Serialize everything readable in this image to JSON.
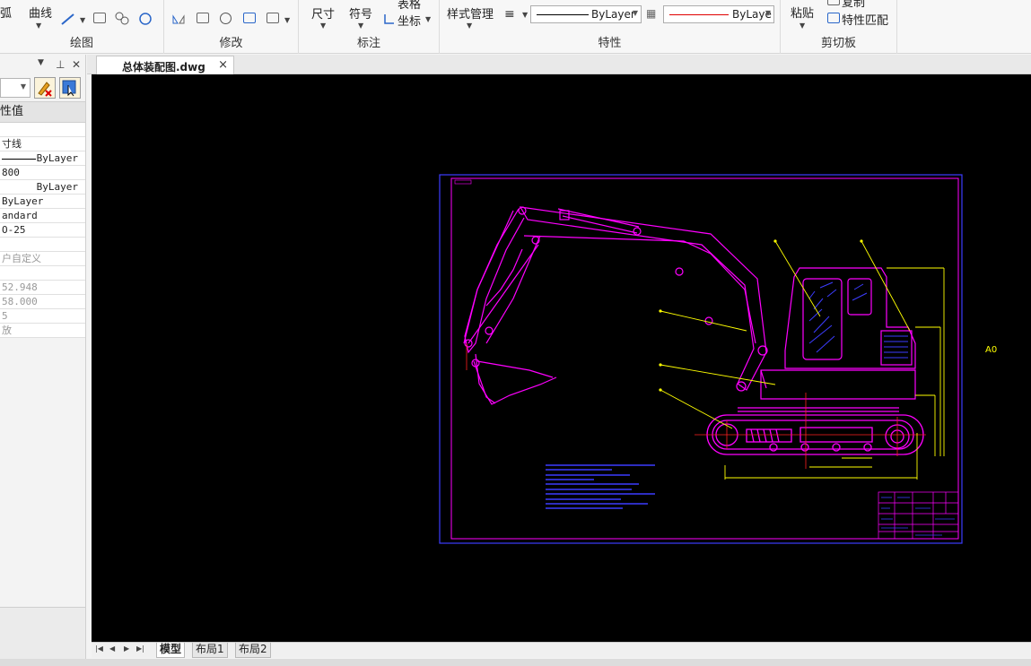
{
  "ribbon": {
    "draw_group": {
      "title": "绘图",
      "arc_label": "弧",
      "curve_label": "曲线"
    },
    "modify_group": {
      "title": "修改"
    },
    "annotate_group": {
      "title": "标注",
      "dimension_label": "尺寸",
      "symbol_label": "符号",
      "table_label": "表格",
      "coord_label": "坐标"
    },
    "props_group": {
      "title": "特性",
      "style_manager_label": "样式管理",
      "linetype_value": "ByLayer",
      "color_value": "ByLaye"
    },
    "clipboard_group": {
      "title": "剪切板",
      "paste_label": "粘贴",
      "copy_label": "复制",
      "match_props_label": "特性匹配"
    }
  },
  "panel": {
    "header_label": "性值",
    "rows": [
      {
        "text": "",
        "gray": false
      },
      {
        "text": "寸线",
        "gray": false
      },
      {
        "text": "ByLayer",
        "gray": false,
        "line": true
      },
      {
        "text": "800",
        "gray": false
      },
      {
        "text": "ByLayer",
        "gray": false,
        "right": true
      },
      {
        "text": "ByLayer",
        "gray": false
      },
      {
        "text": "andard",
        "gray": false
      },
      {
        "text": "O-25",
        "gray": false
      },
      {
        "text": "",
        "gray": false
      },
      {
        "text": "户自定义",
        "gray": true
      },
      {
        "text": "",
        "gray": true
      },
      {
        "text": "52.948",
        "gray": true
      },
      {
        "text": "58.000",
        "gray": true
      },
      {
        "text": "5",
        "gray": true
      },
      {
        "text": "放",
        "gray": true
      }
    ]
  },
  "doc_tab": {
    "name": "总体装配图.dwg",
    "close": "×"
  },
  "drawing": {
    "sheet_label": "A0"
  },
  "layout_tabs": [
    "模型",
    "布局1",
    "布局2"
  ],
  "colors": {
    "canvas": "#000000",
    "border": "#ff00ff",
    "frame": "#0000ff",
    "leader": "#ffff00",
    "dim": "#ff0000"
  }
}
